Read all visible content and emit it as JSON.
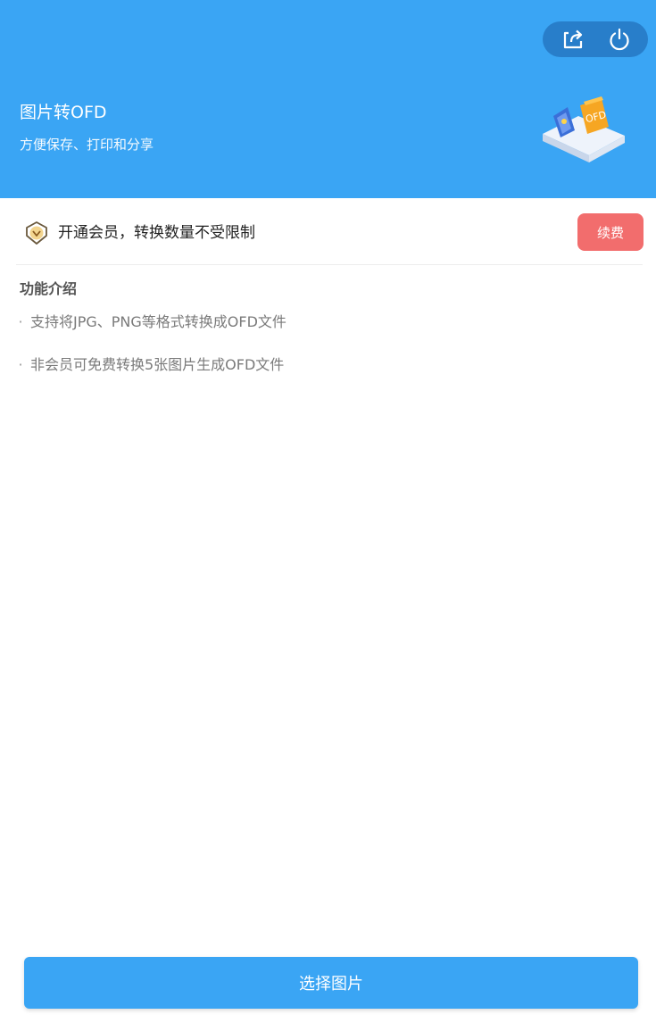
{
  "header": {
    "title": "图片转OFD",
    "subtitle": "方便保存、打印和分享",
    "illustration_label": "OFD",
    "accent_color": "#3aa5f4"
  },
  "capsule": {
    "share_icon": "share-icon",
    "power_icon": "power-icon"
  },
  "vip": {
    "icon": "vip-diamond-icon",
    "text": "开通会员，转换数量不受限制",
    "renew_label": "续费",
    "renew_color": "#f26d6d"
  },
  "features": {
    "title": "功能介绍",
    "items": [
      "支持将JPG、PNG等格式转换成OFD文件",
      "非会员可免费转换5张图片生成OFD文件"
    ],
    "bullet": "·"
  },
  "footer": {
    "select_label": "选择图片"
  }
}
